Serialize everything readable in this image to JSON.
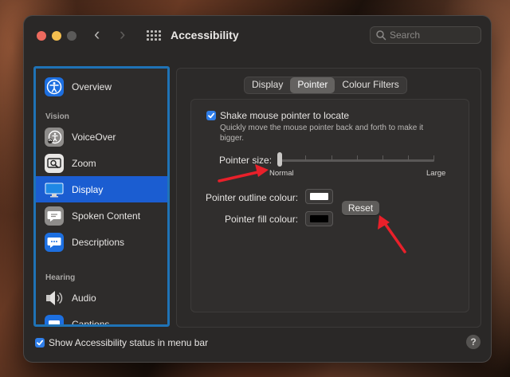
{
  "window": {
    "title": "Accessibility",
    "search_placeholder": "Search"
  },
  "sidebar": {
    "items": [
      {
        "label": "Overview",
        "icon": "accessibility-icon"
      },
      {
        "label": "VoiceOver",
        "icon": "voiceover-icon"
      },
      {
        "label": "Zoom",
        "icon": "zoom-icon"
      },
      {
        "label": "Display",
        "icon": "display-icon",
        "selected": true
      },
      {
        "label": "Spoken Content",
        "icon": "speech-bubble-icon"
      },
      {
        "label": "Descriptions",
        "icon": "descriptions-icon"
      },
      {
        "label": "Audio",
        "icon": "speaker-icon"
      },
      {
        "label": "Captions",
        "icon": "captions-icon"
      }
    ],
    "sections": [
      "Vision",
      "Hearing"
    ]
  },
  "tabs": [
    {
      "label": "Display",
      "active": false
    },
    {
      "label": "Pointer",
      "active": true
    },
    {
      "label": "Colour Filters",
      "active": false
    }
  ],
  "pointer": {
    "shake_label": "Shake mouse pointer to locate",
    "shake_checked": true,
    "shake_help": "Quickly move the mouse pointer back and forth to make it bigger.",
    "size_label": "Pointer size:",
    "size_min": "Normal",
    "size_max": "Large",
    "size_value_fraction": 0.0,
    "outline_label": "Pointer outline colour:",
    "outline_color": "#ffffff",
    "fill_label": "Pointer fill colour:",
    "fill_color": "#000000",
    "reset_label": "Reset"
  },
  "footer": {
    "status_label": "Show Accessibility status in menu bar",
    "status_checked": true,
    "help_label": "?"
  },
  "colors": {
    "accent": "#1b5dd1",
    "annotation_arrow": "#e8202a",
    "sidebar_highlight_border": "#1f73b6"
  }
}
